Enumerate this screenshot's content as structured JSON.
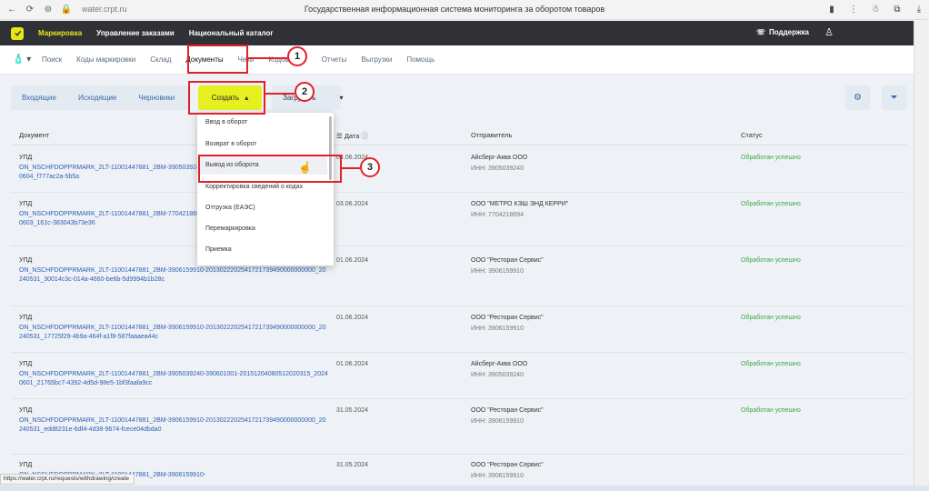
{
  "browser": {
    "url": "water.crpt.ru",
    "title": "Государственная информационная система мониторинга за оборотом товаров",
    "status_url": "https://water.crpt.ru/requests/withdrawing/create"
  },
  "topnav": {
    "items": [
      "Маркировка",
      "Управление заказами",
      "Национальный каталог"
    ],
    "support": "Поддержка"
  },
  "subnav": {
    "items": [
      "Поиск",
      "Коды маркировки",
      "Склад",
      "Документы",
      "Чеки",
      "Кодов Лант",
      "Отчеты",
      "Выгрузки",
      "Помощь"
    ]
  },
  "toolbar": {
    "tabs": [
      "Входящие",
      "Исходящие",
      "Черновики"
    ],
    "create": "Создать",
    "load": "Загрузить"
  },
  "table": {
    "headers": {
      "document": "Документ",
      "date": "Дата",
      "sender": "Отправитель",
      "status": "Статус"
    },
    "rows": [
      {
        "type": "УПД",
        "link": "ON_NSCHFDOPPRMARK_2LT-11001447881_2BM-3905039240-390601001-20151204080512020315_20240604_f777ac2a-5b5a",
        "date": "04.06.2024",
        "sender": "Айсберг-Аква ООО",
        "inn": "ИНН: 3905039240",
        "status": "Обработан успешно"
      },
      {
        "type": "УПД",
        "link": "ON_NSCHFDOPPRMARK_2LT-11001447881_2BM-7704218694-20120528081803513426300000000_20240603_161c-383043b73e36",
        "date": "03.06.2024",
        "sender": "ООО \"МЕТРО КЭШ ЭНД КЕРРИ\"",
        "inn": "ИНН: 7704218694",
        "status": "Обработан успешно"
      },
      {
        "type": "УПД",
        "link": "ON_NSCHFDOPPRMARK_2LT-11001447881_2BM-3906159910-2013022202541721739490000000000_20240531_30014c3c-014a-4660-be6b-5d9994b1b28c",
        "date": "01.06.2024",
        "sender": "ООО \"Ресторан Сервис\"",
        "inn": "ИНН: 3906159910",
        "status": "Обработан успешно"
      },
      {
        "type": "УПД",
        "link": "ON_NSCHFDOPPRMARK_2LT-11001447881_2BM-3906159910-2013022202541721739490000000000_20240531_17725f29-4b9a-464f-a1f8-587faaaea44c",
        "date": "01.06.2024",
        "sender": "ООО \"Ресторан Сервис\"",
        "inn": "ИНН: 3906159910",
        "status": "Обработан успешно"
      },
      {
        "type": "УПД",
        "link": "ON_NSCHFDOPPRMARK_2LT-11001447881_2BM-3905039240-390601001-20151204080512020315_20240601_21765bc7-4392-4d5d-98e5-1bf3faafa9cc",
        "date": "01.06.2024",
        "sender": "Айсберг-Аква ООО",
        "inn": "ИНН: 3905039240",
        "status": "Обработан успешно"
      },
      {
        "type": "УПД",
        "link": "ON_NSCHFDOPPRMARK_2LT-11001447881_2BM-3906159910-2013022202541721739490000000000_20240531_edd8231e-6df4-4d38-9674-fcece04dbda0",
        "date": "31.05.2024",
        "sender": "ООО \"Ресторан Сервис\"",
        "inn": "ИНН: 3906159910",
        "status": "Обработан успешно"
      },
      {
        "type": "УПД",
        "link": "ON_NSCHFDOPPRMARK_2LT-11001447881_2BM-3906159910-",
        "date": "31.05.2024",
        "sender": "ООО \"Ресторан Сервис\"",
        "inn": "ИНН: 3906159910",
        "status": ""
      }
    ]
  },
  "dropdown": {
    "items": [
      "Ввод в оборот",
      "Возврат в оборот",
      "Вывод из оборота",
      "Корректировка сведений о кодах",
      "Отгрузка (ЕАЭС)",
      "Перемаркировка",
      "Приемка"
    ]
  },
  "callouts": [
    "1",
    "2",
    "3"
  ],
  "colors": {
    "accent": "#e6f020",
    "topbar": "#2f3136",
    "link": "#2f5fb3",
    "success": "#3aa64b",
    "highlight": "#e2202a"
  }
}
